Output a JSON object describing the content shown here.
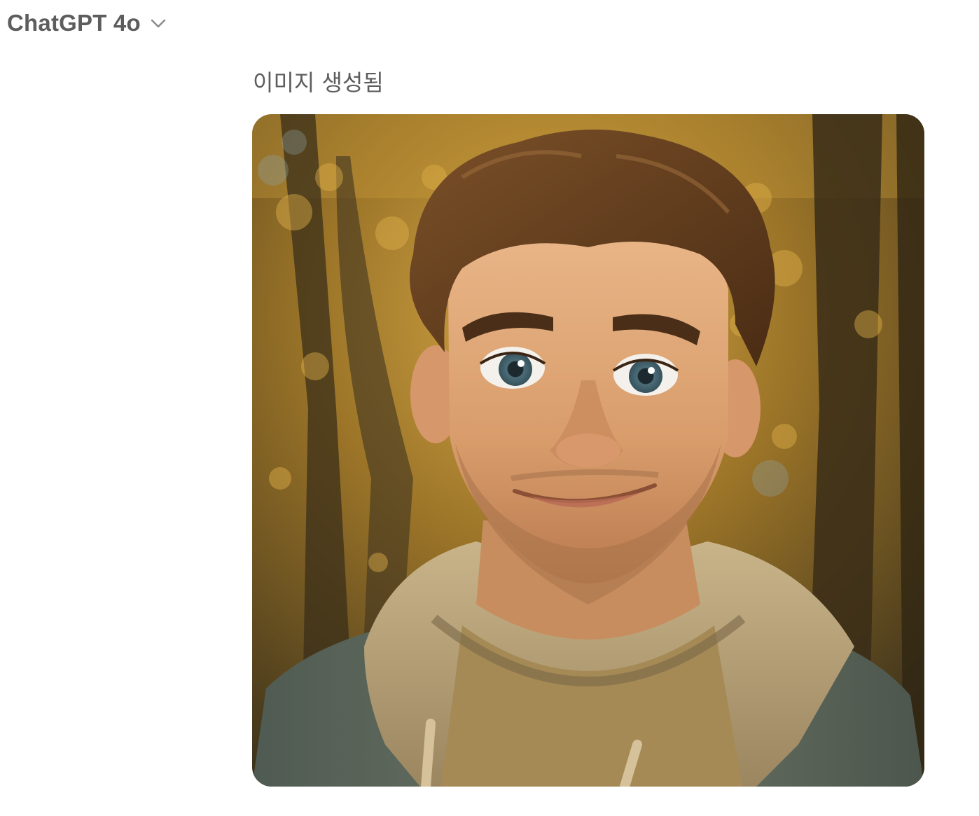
{
  "header": {
    "model_label": "ChatGPT 4o",
    "chevron_icon": "chevron-down-icon"
  },
  "message": {
    "status": "이미지 생성됨",
    "image": {
      "kind": "generated-portrait",
      "palette": {
        "bg_warm": "#b8892f",
        "bg_dark": "#4a3a1c",
        "hair": "#6a4320",
        "skin": "#e0a878",
        "eyes": "#4f6f7a",
        "hoodie": "#b7a27c",
        "jacket": "#5f6a5e",
        "shirt": "#a58a55"
      }
    }
  }
}
